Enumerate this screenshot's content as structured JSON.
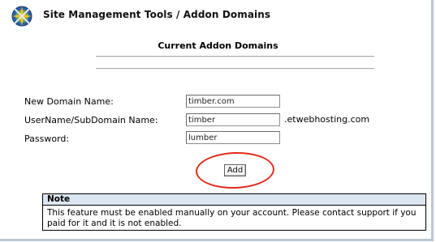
{
  "header": {
    "logo_icon": "compass-logo-icon",
    "title": "Site Management Tools / Addon Domains"
  },
  "section": {
    "title": "Current Addon Domains"
  },
  "form": {
    "domain_label": "New Domain Name:",
    "domain_value": "timber.com",
    "username_label": "UserName/SubDomain Name:",
    "username_value": "timber",
    "username_suffix": ".etwebhosting.com",
    "password_label": "Password:",
    "password_value": "lumber",
    "add_label": "Add"
  },
  "note": {
    "title": "Note",
    "text": "This feature must be enabled manually on your account. Please contact support if you paid for it and it is not enabled."
  },
  "colors": {
    "highlight_circle": "#e12b1a",
    "note_header_bg": "#dce6f2",
    "frame_border": "#b9c6d4"
  }
}
